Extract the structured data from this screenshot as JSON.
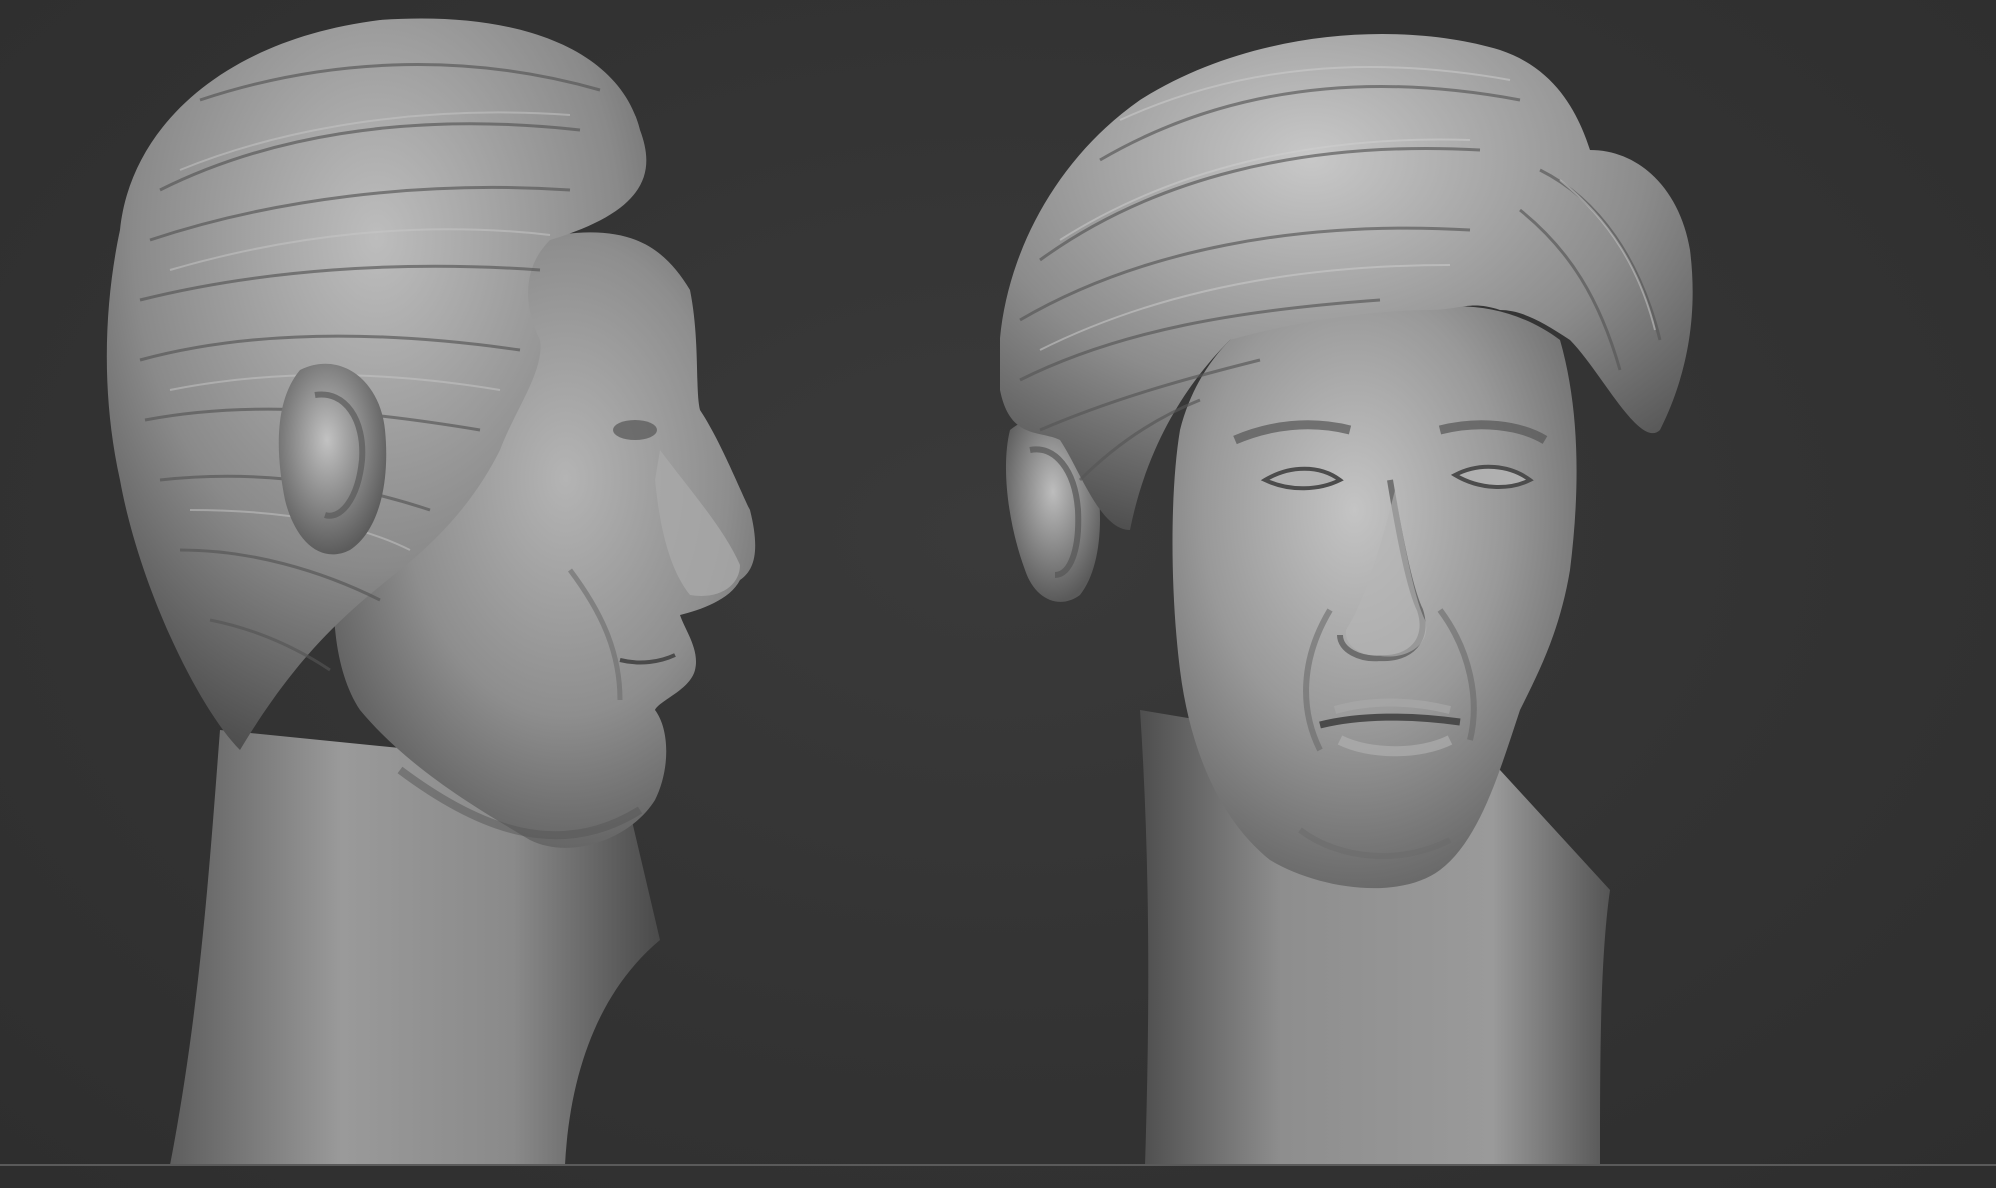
{
  "viewport": {
    "background": "#323232",
    "floor_line_color": "#5a5a5a",
    "clay_color": "#8f8f8f",
    "clay_highlight": "#d6d6d6",
    "clay_shadow": "#3c3c3c"
  },
  "models": [
    {
      "name": "head-profile",
      "view": "profile-right"
    },
    {
      "name": "head-three-quarter",
      "view": "three-quarter-front"
    }
  ]
}
